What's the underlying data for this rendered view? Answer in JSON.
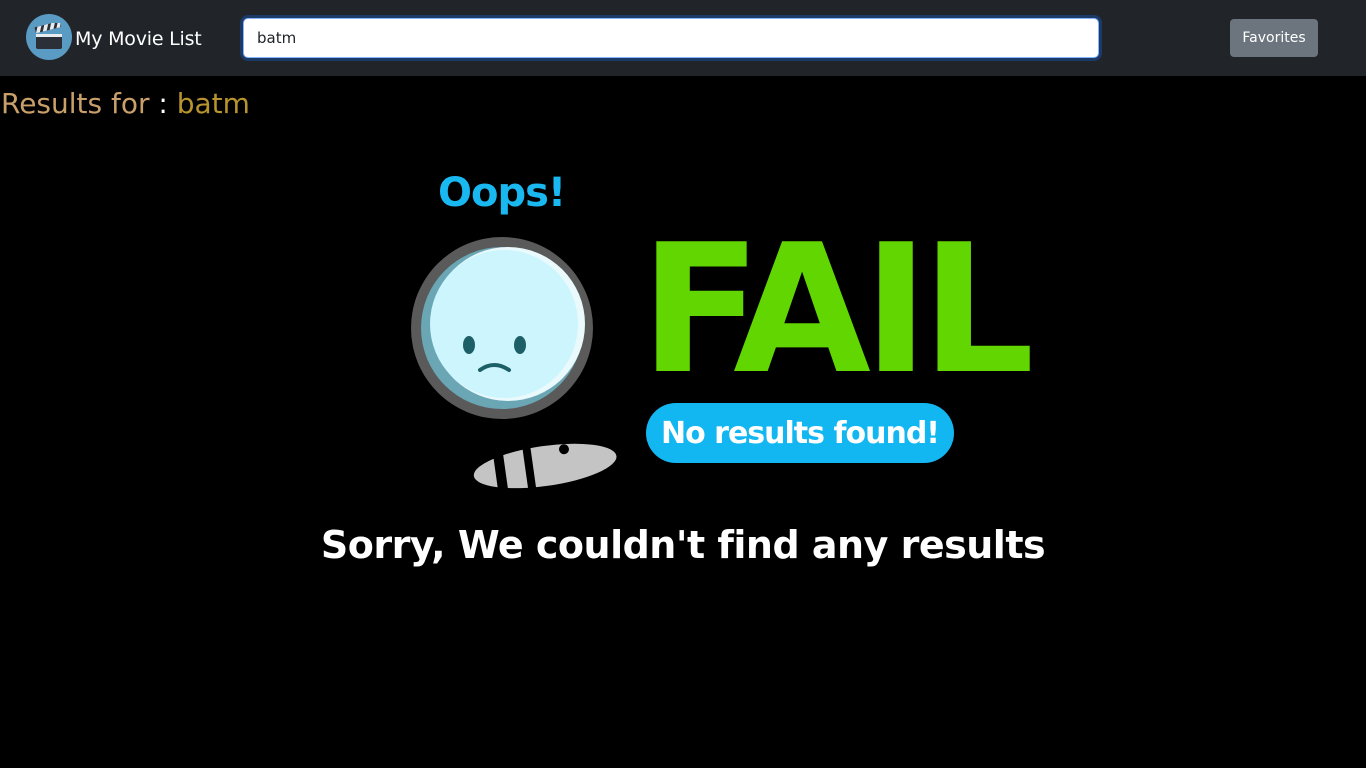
{
  "app": {
    "brand_title": "My Movie List",
    "logo_icon": "film-clapperboard-icon"
  },
  "search": {
    "value": "batm"
  },
  "nav": {
    "favorites_label": "Favorites"
  },
  "results": {
    "label": "Results for",
    "separator": " : ",
    "query": "batm"
  },
  "empty_state": {
    "oops_text": "Oops!",
    "fail_text": "FAIL",
    "pill_text": "No results found!",
    "illustration_icon": "sad-magnifying-glass-icon",
    "message": "Sorry, We couldn't find any results"
  },
  "colors": {
    "navbar": "#212529",
    "background": "#000000",
    "fail_green": "#62d600",
    "accent_blue": "#12b7f2",
    "results_label": "#c9a06a",
    "results_query": "#b7942e",
    "button_gray": "#6c757d"
  }
}
